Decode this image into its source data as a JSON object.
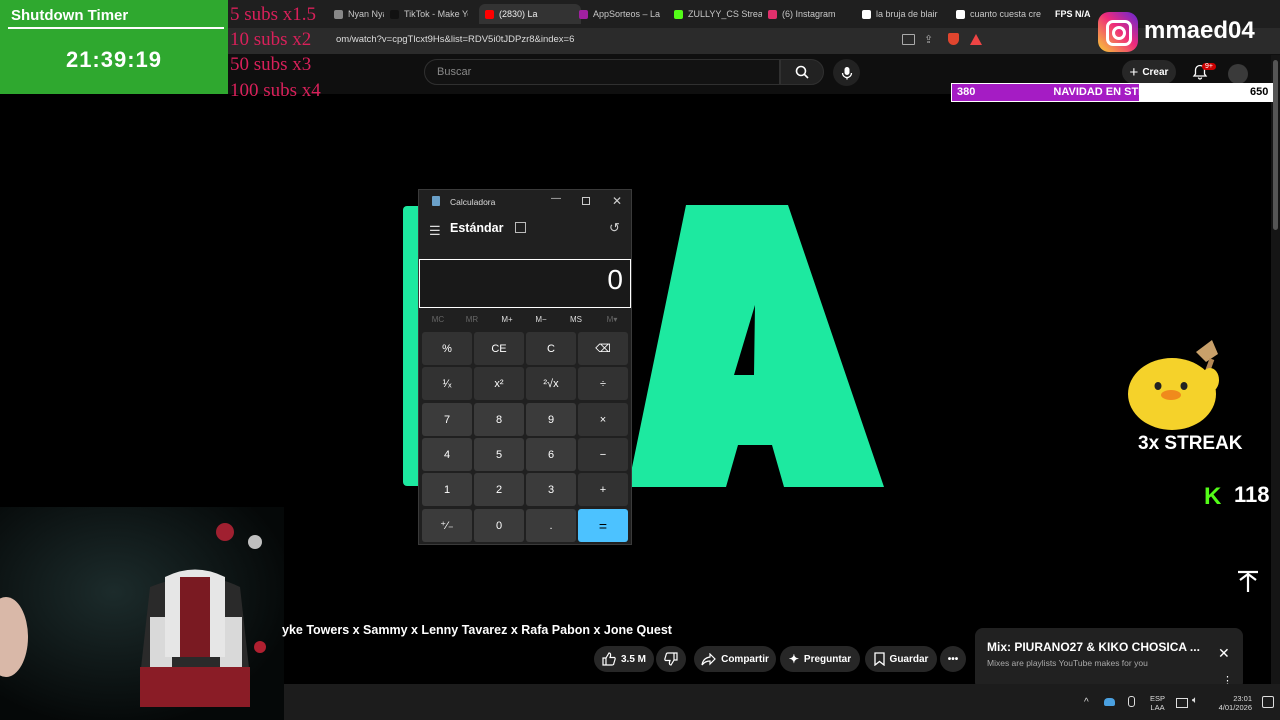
{
  "browser": {
    "tabs": [
      {
        "label": "Nyan Nya",
        "color": "#888888"
      },
      {
        "label": "TikTok - Make Yo",
        "color": "#111111"
      },
      {
        "label": "(2830) La",
        "color": "#ff0000",
        "active": true
      },
      {
        "label": "AppSorteos – La",
        "color": "#a020a0"
      },
      {
        "label": "ZULLYY_CS Strea",
        "color": "#53fc18"
      },
      {
        "label": "(6) Instagram",
        "color": "#e1306c"
      },
      {
        "label": "la bruja de blair",
        "color": "#ffffff"
      },
      {
        "label": "cuanto cuesta cre",
        "color": "#ffffff"
      }
    ],
    "url": "om/watch?v=cpgTlcxt9Hs&list=RDV5i0tJDPzr8&index=6",
    "fps_label": "FPS N/A"
  },
  "youtube": {
    "search_placeholder": "Buscar",
    "create_label": "Crear",
    "notif_badge": "9+",
    "video_title": "yke Towers x Sammy x Lenny Tavarez x Rafa Pabon x Jone Quest",
    "likes": "3.5 M",
    "share_label": "Compartir",
    "ask_label": "Preguntar",
    "save_label": "Guardar",
    "mix_title": "Mix: PIURANO27 & KIKO CHOSICA ...",
    "mix_subtitle": "Mixes are playlists YouTube makes for you"
  },
  "stream_overlay": {
    "timer_title": "Shutdown Timer",
    "timer_value": "21:39:19",
    "subs_rules": [
      "5 subs x1.5",
      "10 subs x2",
      "50 subs x3",
      "100 subs x4"
    ],
    "instagram_handle": "mmaed04",
    "goal_current": "380",
    "goal_title": "NAVIDAD EN STREAM",
    "goal_target": "650",
    "goal_fraction": 0.585,
    "streak_label": "3x STREAK",
    "kick_count": "118",
    "colors": {
      "timer_bg": "#2fa82f",
      "goal_fill": "#a51cc4",
      "subs_text": "#d8205a",
      "kick_green": "#53fc18"
    }
  },
  "calculator": {
    "title": "Calculadora",
    "mode": "Estándar",
    "display": "0",
    "memory": [
      "MC",
      "MR",
      "M+",
      "M−",
      "MS",
      "M▾"
    ],
    "keys": [
      [
        "%",
        "CE",
        "C",
        "⌫"
      ],
      [
        "¹⁄ₓ",
        "x²",
        "²√x",
        "÷"
      ],
      [
        "7",
        "8",
        "9",
        "×"
      ],
      [
        "4",
        "5",
        "6",
        "−"
      ],
      [
        "1",
        "2",
        "3",
        "+"
      ],
      [
        "⁺⁄₋",
        "0",
        ".",
        "="
      ]
    ]
  },
  "taskbar": {
    "lang_top": "ESP",
    "lang_bottom": "LAA",
    "time": "23:01",
    "date": "4/01/2026"
  },
  "video_letter": "A"
}
